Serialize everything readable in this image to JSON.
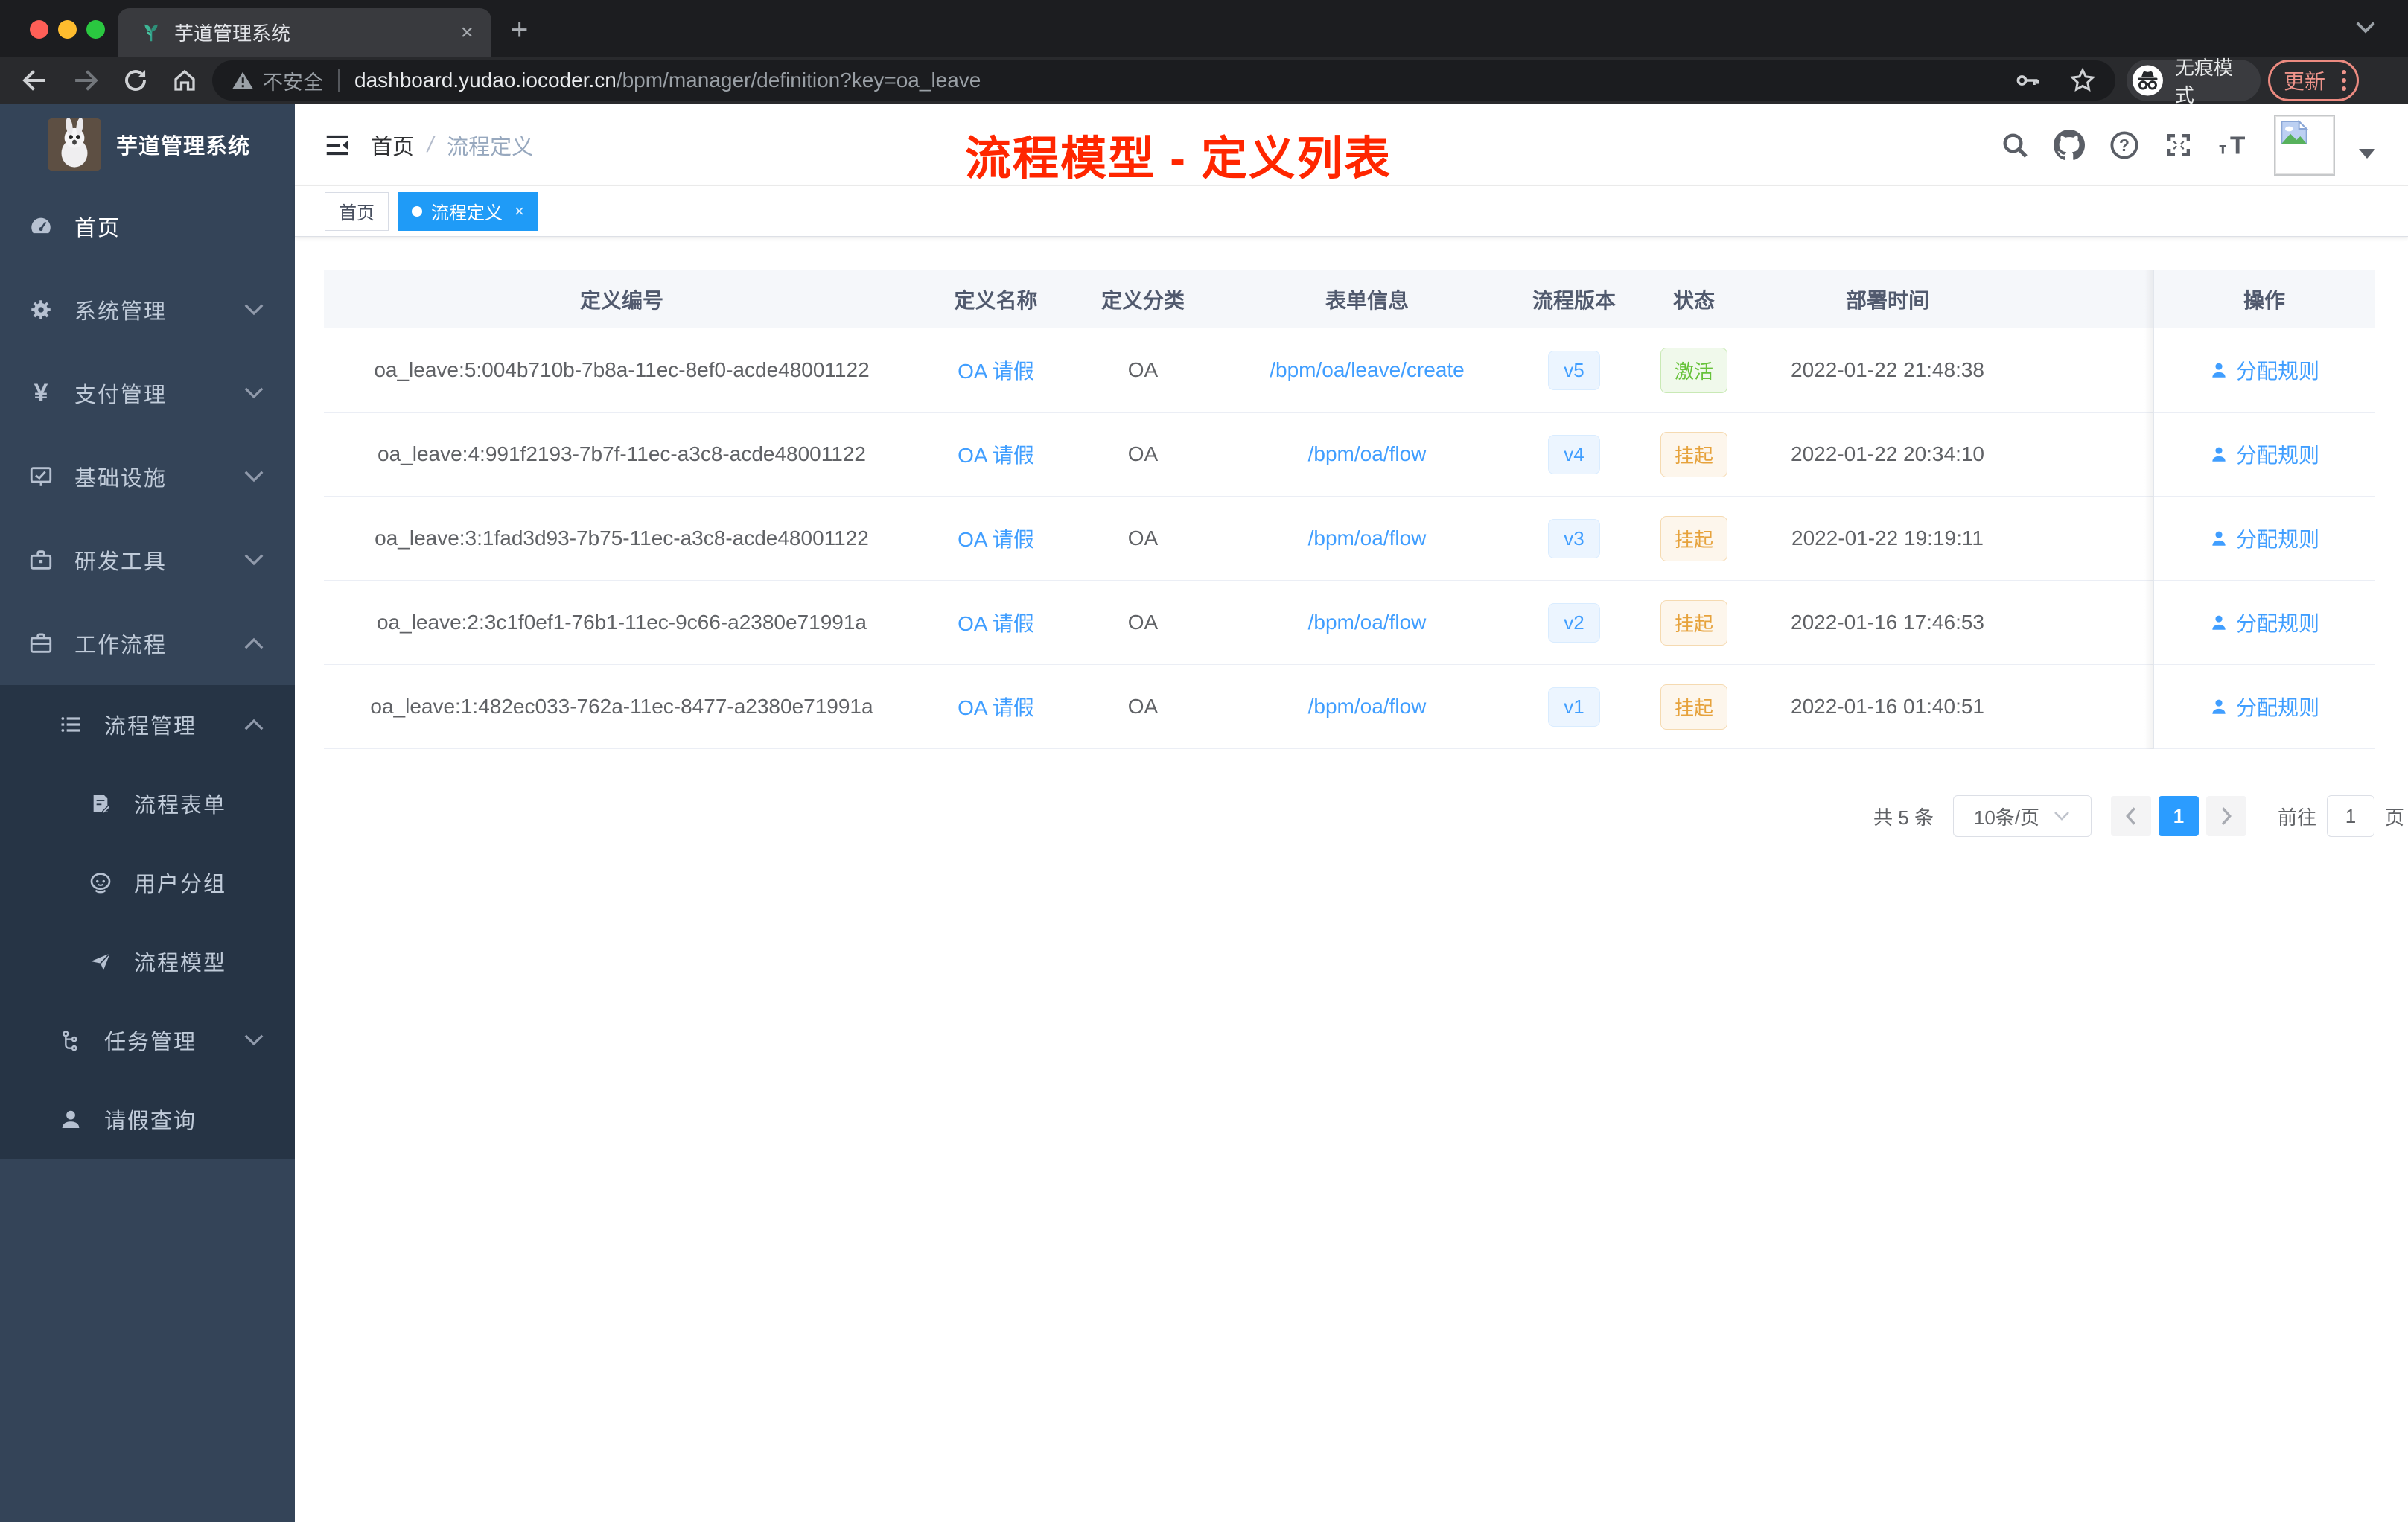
{
  "chrome": {
    "tab": {
      "title": "芋道管理系统",
      "close_label": "×",
      "favicon": "sprout-icon"
    },
    "newtab_label": "+",
    "security_label": "不安全",
    "url": {
      "host": "dashboard.yudao.iocoder.cn",
      "path": "/bpm/manager/definition?key=oa_leave"
    },
    "incognito_label": "无痕模式",
    "update_label": "更新"
  },
  "sidebar": {
    "brand": "芋道管理系统",
    "menu": [
      {
        "label": "首页",
        "icon": "dashboard-icon",
        "expand": null
      },
      {
        "label": "系统管理",
        "icon": "gear-icon",
        "expand": "down"
      },
      {
        "label": "支付管理",
        "icon": "yen-icon",
        "expand": "down"
      },
      {
        "label": "基础设施",
        "icon": "monitor-icon",
        "expand": "down"
      },
      {
        "label": "研发工具",
        "icon": "toolbox-icon",
        "expand": "down"
      },
      {
        "label": "工作流程",
        "icon": "briefcase-icon",
        "expand": "up"
      },
      {
        "label": "流程管理",
        "icon": "list-icon",
        "expand": "up"
      },
      {
        "label": "流程表单",
        "icon": "form-icon",
        "expand": null
      },
      {
        "label": "用户分组",
        "icon": "robot-icon",
        "expand": null
      },
      {
        "label": "流程模型",
        "icon": "send-icon",
        "expand": null
      },
      {
        "label": "任务管理",
        "icon": "flow-icon",
        "expand": "down"
      },
      {
        "label": "请假查询",
        "icon": "user-icon",
        "expand": null
      }
    ]
  },
  "navbar": {
    "breadcrumb": {
      "home": "首页",
      "sep": "/",
      "current": "流程定义"
    },
    "annotation": "流程模型 - 定义列表"
  },
  "tags": {
    "home": {
      "label": "首页"
    },
    "active": {
      "label": "流程定义",
      "close_label": "×"
    }
  },
  "table": {
    "headers": [
      "定义编号",
      "定义名称",
      "定义分类",
      "表单信息",
      "流程版本",
      "状态",
      "部署时间",
      "操作"
    ],
    "action_label": "分配规则",
    "rows": [
      {
        "id": "oa_leave:5:004b710b-7b8a-11ec-8ef0-acde48001122",
        "name": "OA 请假",
        "category": "OA",
        "form": "/bpm/oa/leave/create",
        "version": "v5",
        "status": "激活",
        "deploy_time": "2022-01-22 21:48:38",
        "action": "分配规则"
      },
      {
        "id": "oa_leave:4:991f2193-7b7f-11ec-a3c8-acde48001122",
        "name": "OA 请假",
        "category": "OA",
        "form": "/bpm/oa/flow",
        "version": "v4",
        "status": "挂起",
        "deploy_time": "2022-01-22 20:34:10",
        "action": "分配规则"
      },
      {
        "id": "oa_leave:3:1fad3d93-7b75-11ec-a3c8-acde48001122",
        "name": "OA 请假",
        "category": "OA",
        "form": "/bpm/oa/flow",
        "version": "v3",
        "status": "挂起",
        "deploy_time": "2022-01-22 19:19:11",
        "action": "分配规则"
      },
      {
        "id": "oa_leave:2:3c1f0ef1-76b1-11ec-9c66-a2380e71991a",
        "name": "OA 请假",
        "category": "OA",
        "form": "/bpm/oa/flow",
        "version": "v2",
        "status": "挂起",
        "deploy_time": "2022-01-16 17:46:53",
        "action": "分配规则"
      },
      {
        "id": "oa_leave:1:482ec033-762a-11ec-8477-a2380e71991a",
        "name": "OA 请假",
        "category": "OA",
        "form": "/bpm/oa/flow",
        "version": "v1",
        "status": "挂起",
        "deploy_time": "2022-01-16 01:40:51",
        "action": "分配规则"
      }
    ]
  },
  "pagination": {
    "total": "共 5 条",
    "page_size": "10条/页",
    "current_page": "1",
    "goto_label": "前往",
    "goto_value": "1",
    "unit_label": "页"
  },
  "colors": {
    "accent_blue": "#409eff",
    "tag_active": "#1f9bf7",
    "status_green": "#67c23a",
    "status_orange": "#e6a23c",
    "annotation_red": "#ff2600",
    "sidebar_bg": "#344458",
    "sidebar_nested_bg": "#263445",
    "update_pill": "#ec8a80"
  }
}
